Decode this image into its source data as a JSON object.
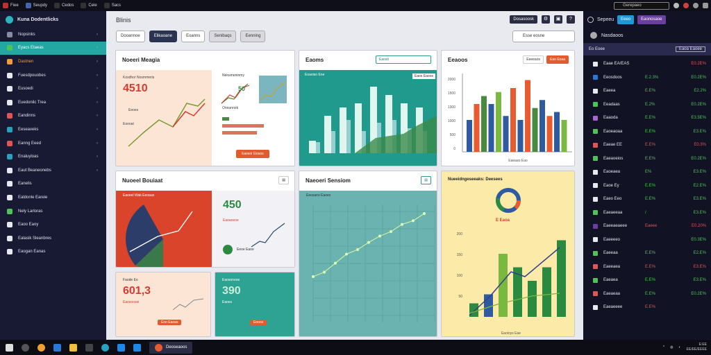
{
  "topbar": {
    "items": [
      "Fiee",
      "Seupdy",
      "Cedos",
      "Ceie",
      "Sacs"
    ],
    "search_placeholder": "Gerepaeo"
  },
  "sidebar": {
    "title": "Kuna Dodentlicks",
    "items": [
      {
        "label": "Nopsinks",
        "active": false
      },
      {
        "label": "Eyacs Etaeas",
        "active": true
      },
      {
        "label": "Dastnen",
        "active": false,
        "orange": true
      },
      {
        "label": "Fuesdpouobes",
        "active": false
      },
      {
        "label": "Eusoedi",
        "active": false
      },
      {
        "label": "Euedonilc Trea",
        "active": false
      },
      {
        "label": "Eandinns",
        "active": false
      },
      {
        "label": "Eeseaveks",
        "active": false
      },
      {
        "label": "Eanng Eeed",
        "active": false
      },
      {
        "label": "Enaluyloas",
        "active": false
      },
      {
        "label": "Eaut Beaneonebs",
        "active": false
      },
      {
        "label": "Eanelis",
        "active": false
      },
      {
        "label": "Ealdonle Eareie",
        "active": false
      },
      {
        "label": "Nely Larloras",
        "active": false
      },
      {
        "label": "Eaoo Eaoy",
        "active": false
      },
      {
        "label": "Ealasik Sleanbres",
        "active": false
      },
      {
        "label": "Eaogan Eanas",
        "active": false
      }
    ]
  },
  "main": {
    "title": "Blinis",
    "toolbar": {
      "button": "Dosasoosk"
    },
    "tabs": [
      "Dooannoe",
      "Elikaoane",
      "Eoanns",
      "Senibaqs",
      "Eenning"
    ],
    "period": "Esse eosne"
  },
  "cards": {
    "c1": {
      "title": "Noeeri Meagia",
      "sub": "Kosdhor Nosmmeris",
      "value": "4510",
      "tag": "Eeoes",
      "lower": "Eoooat",
      "side": "Nensmeninmy",
      "side_value": "50",
      "side_lbl": "Onounnok",
      "btn": "Eaosoi Eiosos"
    },
    "c2": {
      "title": "Eaoms",
      "btn": "Eaosit",
      "badge": "Eaos Eaoos",
      "legend": "Eoaoiso Ene",
      "labels": [
        "Deeo",
        "Eos",
        "Eos"
      ]
    },
    "c3": {
      "title": "Eeaoos",
      "btn1": "Eeeeaos",
      "btn2": "Eao Eoaa",
      "ylabel": "Eaoaio",
      "xlabel": "Eaeaao Eao",
      "ytick": [
        "2000",
        "1500",
        "1300",
        "1000",
        "500",
        "0"
      ]
    },
    "c4": {
      "title": "Nuoeel Bouiaat",
      "sub": "Eaoeel Wak Eeoaus",
      "value": "450",
      "vsub": "Eaoaoeoe",
      "lbl": "Eeoe Eaoe"
    },
    "c5": {
      "title": "Naeoeri Sensiom",
      "sub": "Eeosano Eaoes"
    },
    "c6": {
      "title": "Nueeidngeseeaks: Deesees",
      "yticks": [
        "200",
        "150",
        "100",
        "50"
      ],
      "xlbl": "Eaoloys Eae",
      "val": "E Eaoa"
    },
    "c7": {
      "title": "Faode Eo",
      "value": "601,3",
      "sub": "Eaosoosei",
      "btn": "Eoo Eaoas"
    },
    "c8": {
      "title": "Eaosonooe",
      "value": "390",
      "sub": "Eaoes",
      "btn": "Eooos"
    }
  },
  "chart_data": [
    {
      "type": "bar",
      "categories": [
        "1",
        "2",
        "3",
        "4",
        "5",
        "6",
        "7",
        "8"
      ],
      "series": [
        {
          "values": [
            15,
            45,
            55,
            60,
            80,
            70,
            60,
            55
          ]
        },
        {
          "values": [
            20,
            40,
            60,
            40,
            55,
            60,
            45,
            40
          ]
        }
      ]
    },
    {
      "type": "bar",
      "categories": [
        "1",
        "2",
        "3",
        "4",
        "5",
        "6",
        "7",
        "8",
        "9",
        "10",
        "11",
        "12",
        "13",
        "14"
      ],
      "series": [
        {
          "values": [
            40,
            60,
            70,
            60,
            75,
            45,
            80,
            40,
            90,
            55,
            65,
            45,
            50,
            40
          ]
        }
      ]
    },
    {
      "type": "line",
      "x": [
        1,
        2,
        3,
        4,
        5,
        6,
        7,
        8,
        9,
        10,
        11
      ],
      "series": [
        {
          "values": [
            20,
            25,
            35,
            45,
            50,
            58,
            65,
            70,
            78,
            82,
            90
          ]
        }
      ]
    }
  ],
  "right_panel": {
    "head_title": "Sepeeu",
    "btn1": "Eeeo",
    "btn2": "Eaonosaoe",
    "user": "Nasdaoos",
    "sub": "Eo Eoee",
    "sub_btn": "Eaoa Eaoee",
    "rows": [
      {
        "name": "Eaae EA/EAS",
        "chg": "",
        "val": "E0.2E%",
        "color": "#e05555"
      },
      {
        "name": "Eeosdoos",
        "chg": "E.2.3%",
        "val": "E0.2E%",
        "color": "#4fc25a"
      },
      {
        "name": "Eaeea",
        "chg": "E.E%",
        "val": "E2.2%",
        "color": "#4fc25a"
      },
      {
        "name": "Eeadaas",
        "chg": "E.2%",
        "val": "E0.2E%",
        "color": "#4fc25a"
      },
      {
        "name": "Eaaoda",
        "chg": "E.E%",
        "val": "E3.5E%",
        "color": "#4fc25a"
      },
      {
        "name": "Eaoeaoaa",
        "chg": "E.E%",
        "val": "E3.E%",
        "color": "#4fc25a"
      },
      {
        "name": "Eaeae EE",
        "chg": "E.E%",
        "val": "E0.3%",
        "color": "#e05555"
      },
      {
        "name": "Eaeaoeios",
        "chg": "E.E%",
        "val": "E0.2E%",
        "color": "#4fc25a"
      },
      {
        "name": "Eaoeaea",
        "chg": "E%",
        "val": "E3.E%",
        "color": "#4fc25a"
      },
      {
        "name": "Eaoe Ey",
        "chg": "E.E%",
        "val": "E2.E%",
        "color": "#4fc25a"
      },
      {
        "name": "Eaeo Eeo",
        "chg": "E.E%",
        "val": "E3.E%",
        "color": "#4fc25a"
      },
      {
        "name": "Eaeaeeaa",
        "chg": "/",
        "val": "E3.E%",
        "color": "#4fc25a"
      },
      {
        "name": "Eaeeaeaeee",
        "chg": "Eaeee",
        "val": "E0.20%",
        "color": "#e05555"
      },
      {
        "name": "Eaeeeeo",
        "chg": "",
        "val": "E0.3E%",
        "color": "#4fc25a"
      },
      {
        "name": "Eaeeaa",
        "chg": "E.E%",
        "val": "E2.E%",
        "color": "#4fc25a"
      },
      {
        "name": "Eaeeaea",
        "chg": "E.E%",
        "val": "E3.E%",
        "color": "#e05555"
      },
      {
        "name": "Eaeaea",
        "chg": "E.E%",
        "val": "E3.E%",
        "color": "#4fc25a"
      },
      {
        "name": "Eaeaeaa",
        "chg": "E.E%",
        "val": "E0.2E%",
        "color": "#4fc25a"
      },
      {
        "name": "Eaeaeeee",
        "chg": "E.E%",
        "val": "",
        "color": "#e05555"
      }
    ]
  },
  "taskbar": {
    "app": "Deoseaoos",
    "time": "E:EE",
    "date": "EE/EE/EEEE"
  }
}
